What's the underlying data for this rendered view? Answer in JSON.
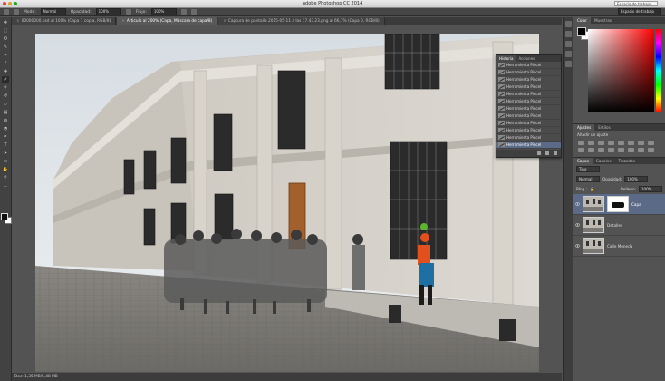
{
  "titlebar": {
    "title": "Adobe Photoshop CC 2014",
    "workspace": "Espacio de trabajo"
  },
  "options": {
    "mode_label": "Modo:",
    "mode_value": "Normal",
    "opacity_label": "Opacidad:",
    "opacity_value": "100%",
    "flow_label": "Flujo:",
    "flow_value": "100%"
  },
  "tabs": [
    {
      "label": "00000000.psd al 100% (Capa 7 copia, RGB/8)",
      "active": false
    },
    {
      "label": "Articulo al 200% (Capa, Máscara de capa/8)",
      "active": true
    },
    {
      "label": "Captura de pantalla 2015-05-11 a las 17.43.23.png al 66,7% (Capa 0, RGB/8)",
      "active": false
    }
  ],
  "status": {
    "text": "Doc: 1,35 MB/5,48 MB"
  },
  "history": {
    "tabs": [
      "Historia",
      "Acciones"
    ],
    "items": [
      "Herramienta Pincel",
      "Herramienta Pincel",
      "Herramienta Pincel",
      "Herramienta Pincel",
      "Herramienta Pincel",
      "Herramienta Pincel",
      "Herramienta Pincel",
      "Herramienta Pincel",
      "Herramienta Pincel",
      "Herramienta Pincel",
      "Herramienta Pincel",
      "Herramienta Pincel"
    ],
    "selected_index": 11
  },
  "panels": {
    "color_tabs": [
      "Color",
      "Muestras"
    ],
    "adjust_tabs": [
      "Ajustes",
      "Estilos"
    ],
    "adjust_label": "Añadir un ajuste",
    "layers_tabs": [
      "Capas",
      "Canales",
      "Trazados"
    ],
    "kind_label": "Tipo",
    "blend_value": "Normal",
    "opacity_label": "Opacidad:",
    "opacity_value": "100%",
    "lock_label": "Bloq.:",
    "fill_label": "Relleno:",
    "fill_value": "100%"
  },
  "layers": [
    {
      "name": "Capa",
      "selected": true,
      "has_mask": true
    },
    {
      "name": "Detalles",
      "selected": false,
      "has_mask": false
    },
    {
      "name": "Calle Moneda",
      "selected": false,
      "has_mask": false
    }
  ],
  "colors": {
    "accent": "#5b6a87",
    "panel": "#535353",
    "fg": "#000000",
    "bg": "#ffffff"
  }
}
